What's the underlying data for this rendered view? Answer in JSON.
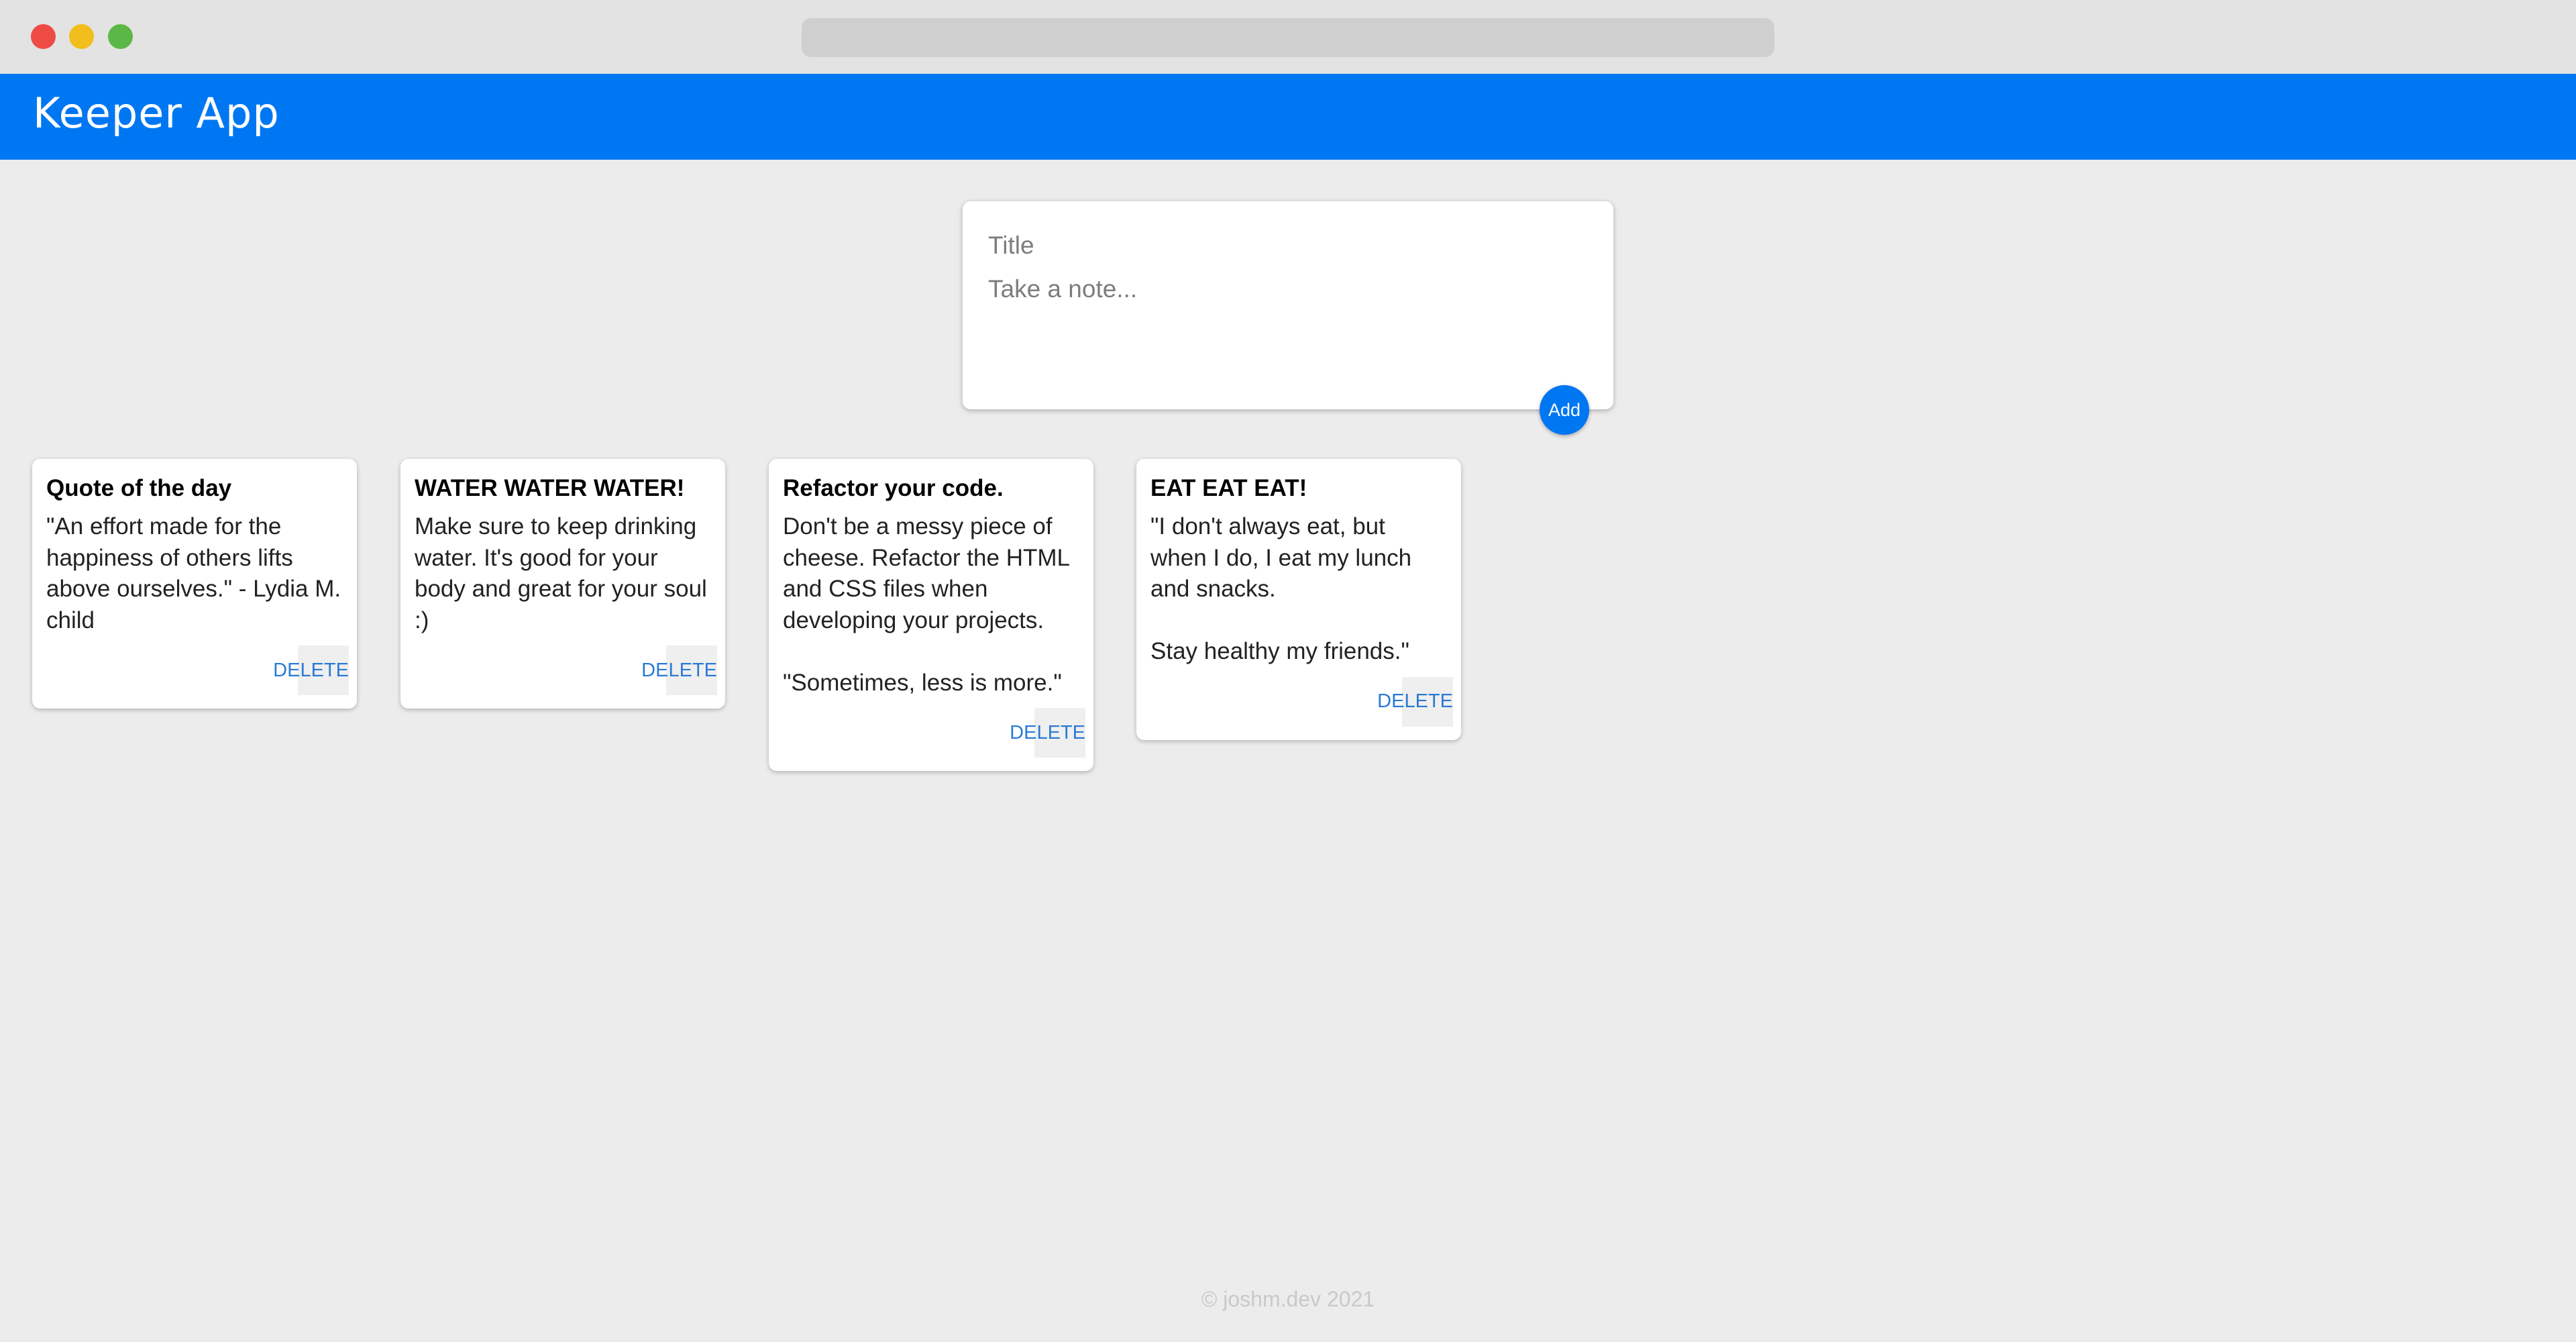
{
  "app": {
    "title": "Keeper App"
  },
  "create": {
    "title_placeholder": "Title",
    "content_placeholder": "Take a note...",
    "add_label": "Add"
  },
  "notes": [
    {
      "title": "Quote of the day",
      "content": "\"An effort made for the happiness of others lifts above ourselves.\" - Lydia M. child",
      "delete_label": "DELETE"
    },
    {
      "title": "WATER WATER WATER!",
      "content": "Make sure to keep drinking water. It's good for your body and great for your soul :)",
      "delete_label": "DELETE"
    },
    {
      "title": "Refactor your code.",
      "content": "Don't be a messy piece of cheese. Refactor the HTML and CSS files when developing your projects.\n\n\"Sometimes, less is more.\"",
      "delete_label": "DELETE"
    },
    {
      "title": "EAT EAT EAT!",
      "content": "\"I don't always eat, but when I do, I eat my lunch and snacks.\n\nStay healthy my friends.\"",
      "delete_label": "DELETE"
    }
  ],
  "footer": {
    "text": "© joshm.dev 2021"
  },
  "colors": {
    "brand": "#0077f2",
    "background": "#ececec",
    "delete_text": "#2a7ad6"
  }
}
